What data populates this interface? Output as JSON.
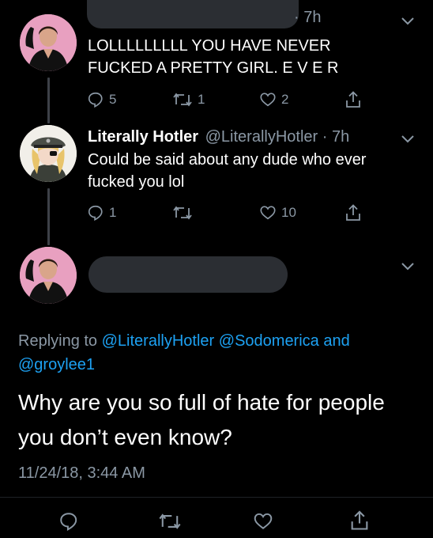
{
  "tweet1": {
    "timestamp": "· 7h",
    "text_line1": "LOLLLLLLLLL YOU HAVE NEVER",
    "text_line2": "FUCKED A PRETTY GIRL. E V E R",
    "replies": "5",
    "retweets": "1",
    "likes": "2"
  },
  "tweet2": {
    "display_name": "Literally Hotler",
    "handle_time": "@LiterallyHotler · 7h",
    "text_line1": "Could be said about any dude who ever",
    "text_line2": "fucked you lol",
    "replies": "1",
    "retweets": "",
    "likes": "10"
  },
  "tweet3": {
    "replying_prefix": "Replying to",
    "mention1": "@LiterallyHotler",
    "mention2": "@Sodomerica",
    "and_word": "and",
    "mention3": "@groylee1",
    "text_line1": "Why are you so full of hate for people",
    "text_line2": "you don’t even know?",
    "date": "11/24/18, 3:44 AM"
  },
  "icons": {
    "reply": "reply-icon",
    "retweet": "retweet-icon",
    "like": "heart-icon",
    "share": "share-icon",
    "menu": "chevron-down-icon"
  },
  "colors": {
    "background": "#000000",
    "muted": "#8b98a5",
    "link": "#1da1f2",
    "avatar_pink": "#e8a0c0"
  }
}
